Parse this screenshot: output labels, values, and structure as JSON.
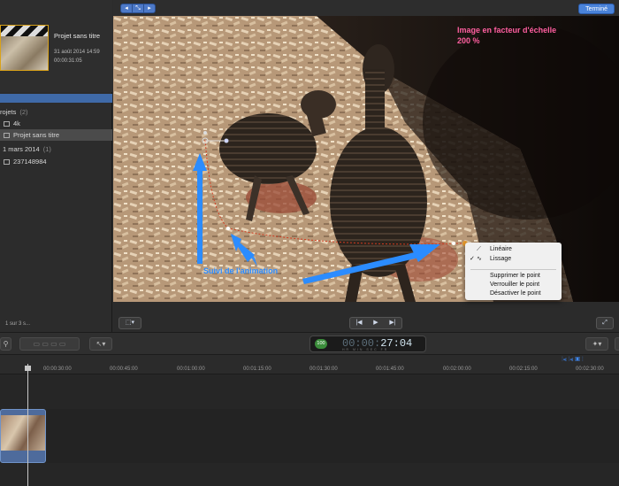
{
  "library": {
    "project_title": "Projet sans titre",
    "project_date": "31 août 2014 14:59",
    "project_duration": "00:00:31:05",
    "rows": [
      {
        "label": "rojets",
        "count": "(2)"
      },
      {
        "label": "4k",
        "count": ""
      },
      {
        "label": "Projet sans titre",
        "count": ""
      },
      {
        "label": "1 mars 2014",
        "count": "(1)"
      },
      {
        "label": "237148984",
        "count": ""
      }
    ],
    "pager": "1 sur 3 s..."
  },
  "viewer": {
    "done_label": "Terminé",
    "scale_note_line1": "Image en facteur d'échelle",
    "scale_note_line2": "200 %",
    "annotation": "Suivi de l'animation"
  },
  "context_menu": {
    "items": [
      {
        "label": "Linéaire",
        "checked": false,
        "icon": "linear-curve-icon"
      },
      {
        "label": "Lissage",
        "checked": true,
        "icon": "smooth-curve-icon"
      },
      {
        "label": "Supprimer le point"
      },
      {
        "label": "Verrouiller le point"
      },
      {
        "label": "Désactiver le point"
      }
    ]
  },
  "toolbar": {
    "timecode_badge": "100",
    "timecode_hidden": "00:00:",
    "timecode_visible": "27:04",
    "timecode_units": "HR MIN SEC FR"
  },
  "timeline": {
    "ticks": [
      "00:00:30:00",
      "00:00:45:00",
      "00:01:00:00",
      "00:01:15:00",
      "00:01:30:00",
      "00:01:45:00",
      "00:02:00:00",
      "00:02:15:00",
      "00:02:30:00"
    ]
  },
  "colors": {
    "accent_blue": "#2b8cff",
    "note_pink": "#ff5fa0",
    "selection_bar": "#3f6aa8"
  }
}
